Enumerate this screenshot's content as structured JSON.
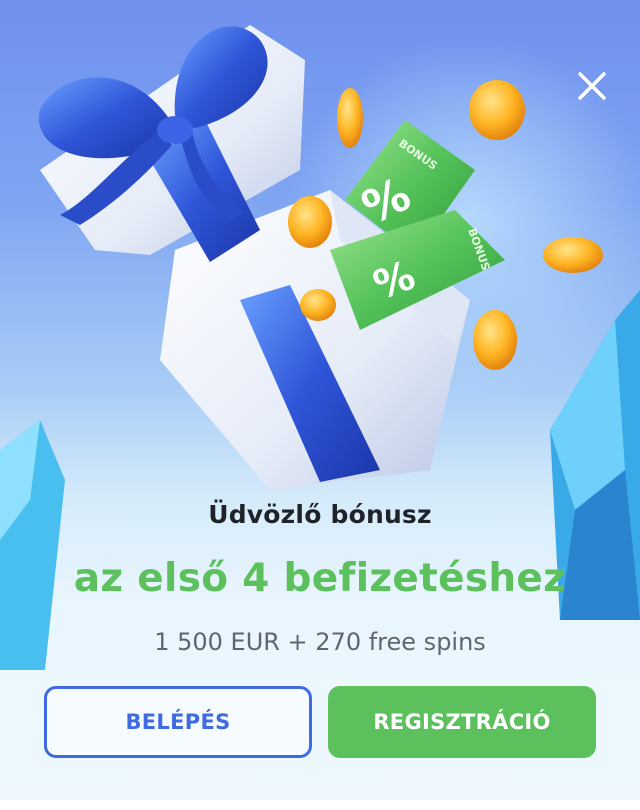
{
  "popup": {
    "title": "Üdvözlő bónusz",
    "subtitle": "az első 4 befizetéshez",
    "offer": "1 500 EUR + 270 free spins",
    "hero_icons": [
      "gift-box-icon",
      "bonus-ticket-icon",
      "coin-icon",
      "crystal-icon"
    ],
    "ticket_label": "BONUS",
    "ticket_symbol": "%"
  },
  "buttons": {
    "login_label": "BELÉPÉS",
    "register_label": "REGISZTRÁCIÓ"
  },
  "colors": {
    "accent_green": "#5cc15c",
    "accent_blue": "#3f6ae0",
    "title_text": "#1f2228",
    "offer_text": "#5f6670"
  }
}
